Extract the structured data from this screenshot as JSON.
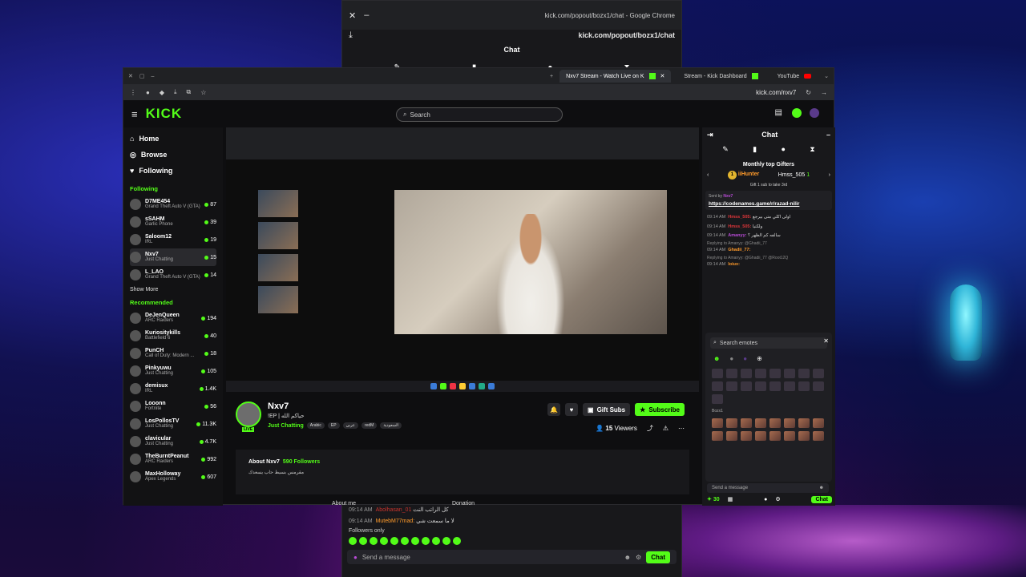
{
  "popout": {
    "url_line1": "kick.com/popout/bozx1/chat - Google Chrome",
    "url_line2": "kick.com/popout/bozx1/chat",
    "title": "Chat",
    "messages": [
      {
        "time": "09:14 AM",
        "user": "Abolhasan_01",
        "text": "كل الراتب النت"
      },
      {
        "time": "09:14 AM",
        "user": "MutebM77mad:",
        "text": "لا ما سمعت شي"
      }
    ],
    "followers_only": "Followers only",
    "send_placeholder": "Send a message",
    "chat_button": "Chat"
  },
  "tabs": [
    {
      "label": "Nxv7 Stream - Watch Live on K"
    },
    {
      "label": "Stream - Kick Dashboard"
    },
    {
      "label": "YouTube"
    }
  ],
  "toolbar": {
    "url": "kick.com/nxv7"
  },
  "kick": {
    "logo": "KICK",
    "search_placeholder": "Search",
    "nav": [
      {
        "label": "Home"
      },
      {
        "label": "Browse"
      },
      {
        "label": "Following"
      }
    ],
    "following_title": "Following",
    "following": [
      {
        "name": "D7ME454",
        "category": "Grand Theft Auto V (GTA)",
        "count": "87"
      },
      {
        "name": "sSAHM",
        "category": "Garlic Phone",
        "count": "39"
      },
      {
        "name": "Saloom12",
        "category": "IRL",
        "count": "19"
      },
      {
        "name": "Nxv7",
        "category": "Just Chatting",
        "count": "15"
      },
      {
        "name": "L_LAO",
        "category": "Grand Theft Auto V (GTA)",
        "count": "14"
      }
    ],
    "show_more": "Show More",
    "recommended_title": "Recommended",
    "recommended": [
      {
        "name": "DeJenQueen",
        "category": "ARC Raiders",
        "count": "194"
      },
      {
        "name": "Kuriositykills",
        "category": "Battlefield 6",
        "count": "40"
      },
      {
        "name": "PunCH",
        "category": "Call of Duty: Modern ...",
        "count": "18"
      },
      {
        "name": "Pinkyuwu",
        "category": "Just Chatting",
        "count": "105"
      },
      {
        "name": "demisux",
        "category": "IRL",
        "count": "1.4K"
      },
      {
        "name": "Looonn",
        "category": "Fortnite",
        "count": "56"
      },
      {
        "name": "LosPollosTV",
        "category": "Just Chatting",
        "count": "11.3K"
      },
      {
        "name": "clavicular",
        "category": "Just Chatting",
        "count": "4.7K"
      },
      {
        "name": "TheBurntPeanut",
        "category": "ARC Raiders",
        "count": "992"
      },
      {
        "name": "MaxHolloway",
        "category": "Apex Legends",
        "count": "607"
      }
    ]
  },
  "stream": {
    "name": "Nxv7",
    "title": "!EP | حياكم الله",
    "live": "LIVE",
    "category": "Just Chatting",
    "tags": [
      "Arabic",
      "EP",
      "عربي",
      "redM",
      "السعودية"
    ],
    "gift_label": "Gift Subs",
    "subscribe_label": "Subscribe",
    "viewers": "15",
    "viewers_label": "Viewers",
    "about_title": "About Nxv7",
    "followers": "590 Followers",
    "about_text": "مقرمس بسيط حاب يسعدك",
    "under_left": "About me",
    "under_right": "Donation"
  },
  "chat": {
    "title": "Chat",
    "gifters_title": "Monthly top Gifters",
    "gifter1": "iiHunter",
    "gifter2": "Hmss_505",
    "gifter2_count": "1",
    "gifter_note": "Gift 1 sub to take 3rd",
    "pinned_by": "Sent by",
    "pinned_user": "Nxv7",
    "pinned_link": "https://codenames.game/r/razad-nilir",
    "messages": [
      {
        "time": "09:14 AM",
        "user": "Hmss_505:",
        "cls": "r",
        "text": "اولى اكلي متى بيرجع"
      },
      {
        "time": "09:14 AM",
        "user": "Hmss_505:",
        "cls": "r",
        "text": "ولكنيا"
      },
      {
        "time": "09:14 AM",
        "user": "Amanyy:",
        "cls": "p",
        "text": "سالفه كم الظهر ؟"
      },
      {
        "time": "09:14 AM",
        "user": "Ghadii_77:",
        "cls": "o",
        "text": ""
      },
      {
        "time": "09:14 AM",
        "user": "loiux:",
        "cls": "o",
        "text": ""
      }
    ],
    "replies": [
      "Replying to Amanyy: @Ghadii_77",
      "Replying to Amanyy: @Ghadii_77 @Root12Q"
    ],
    "emote_search": "Search emotes",
    "emote_section": "Bozx1",
    "send_placeholder": "Send a message",
    "points": "30",
    "chat_button": "Chat"
  },
  "colors": {
    "kick_green": "#53fc18",
    "bg": "#0e0e10"
  }
}
